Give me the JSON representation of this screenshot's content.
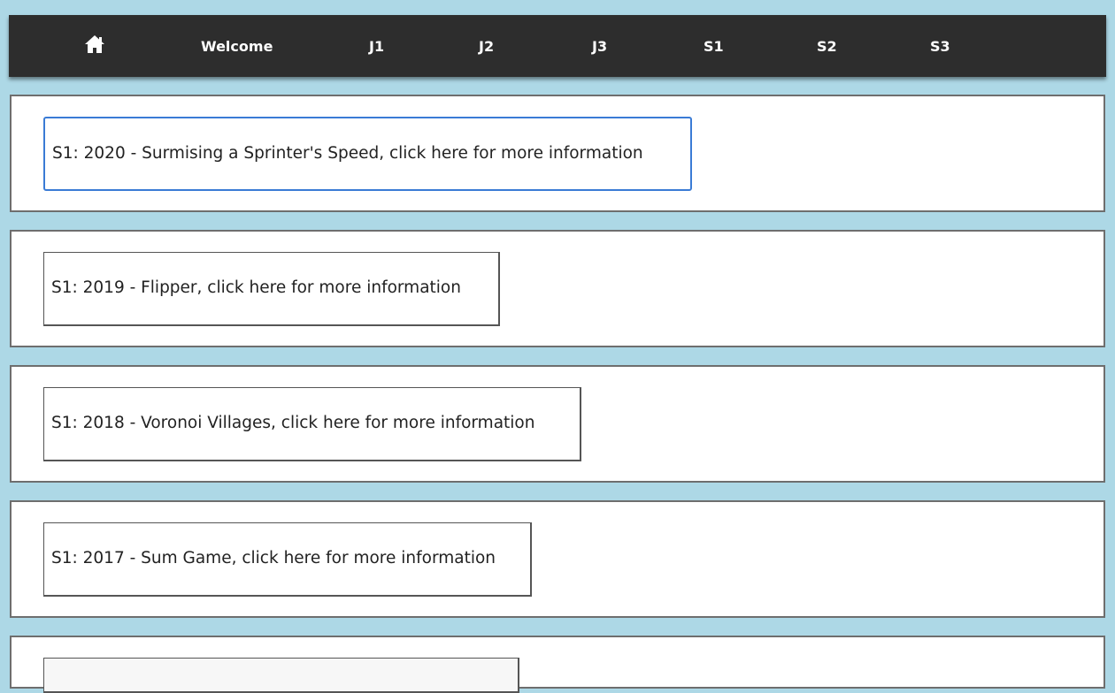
{
  "nav": {
    "home_icon": "home-icon",
    "items": [
      {
        "label": "Welcome"
      },
      {
        "label": "J1"
      },
      {
        "label": "J2"
      },
      {
        "label": "J3"
      },
      {
        "label": "S1"
      },
      {
        "label": "S2"
      },
      {
        "label": "S3"
      }
    ]
  },
  "panels": [
    {
      "button_label": "S1: 2020 - Surmising a Sprinter's Speed, click here for more information",
      "focused": true
    },
    {
      "button_label": "S1: 2019 - Flipper, click here for more information",
      "focused": false
    },
    {
      "button_label": "S1: 2018 - Voronoi Villages, click here for more information",
      "focused": false
    },
    {
      "button_label": "S1: 2017 - Sum Game, click here for more information",
      "focused": false
    },
    {
      "button_label": "",
      "focused": false
    }
  ],
  "colors": {
    "page_background": "#add8e6",
    "navbar_background": "#2d2d2d",
    "focus_border": "#3a7bd5"
  }
}
